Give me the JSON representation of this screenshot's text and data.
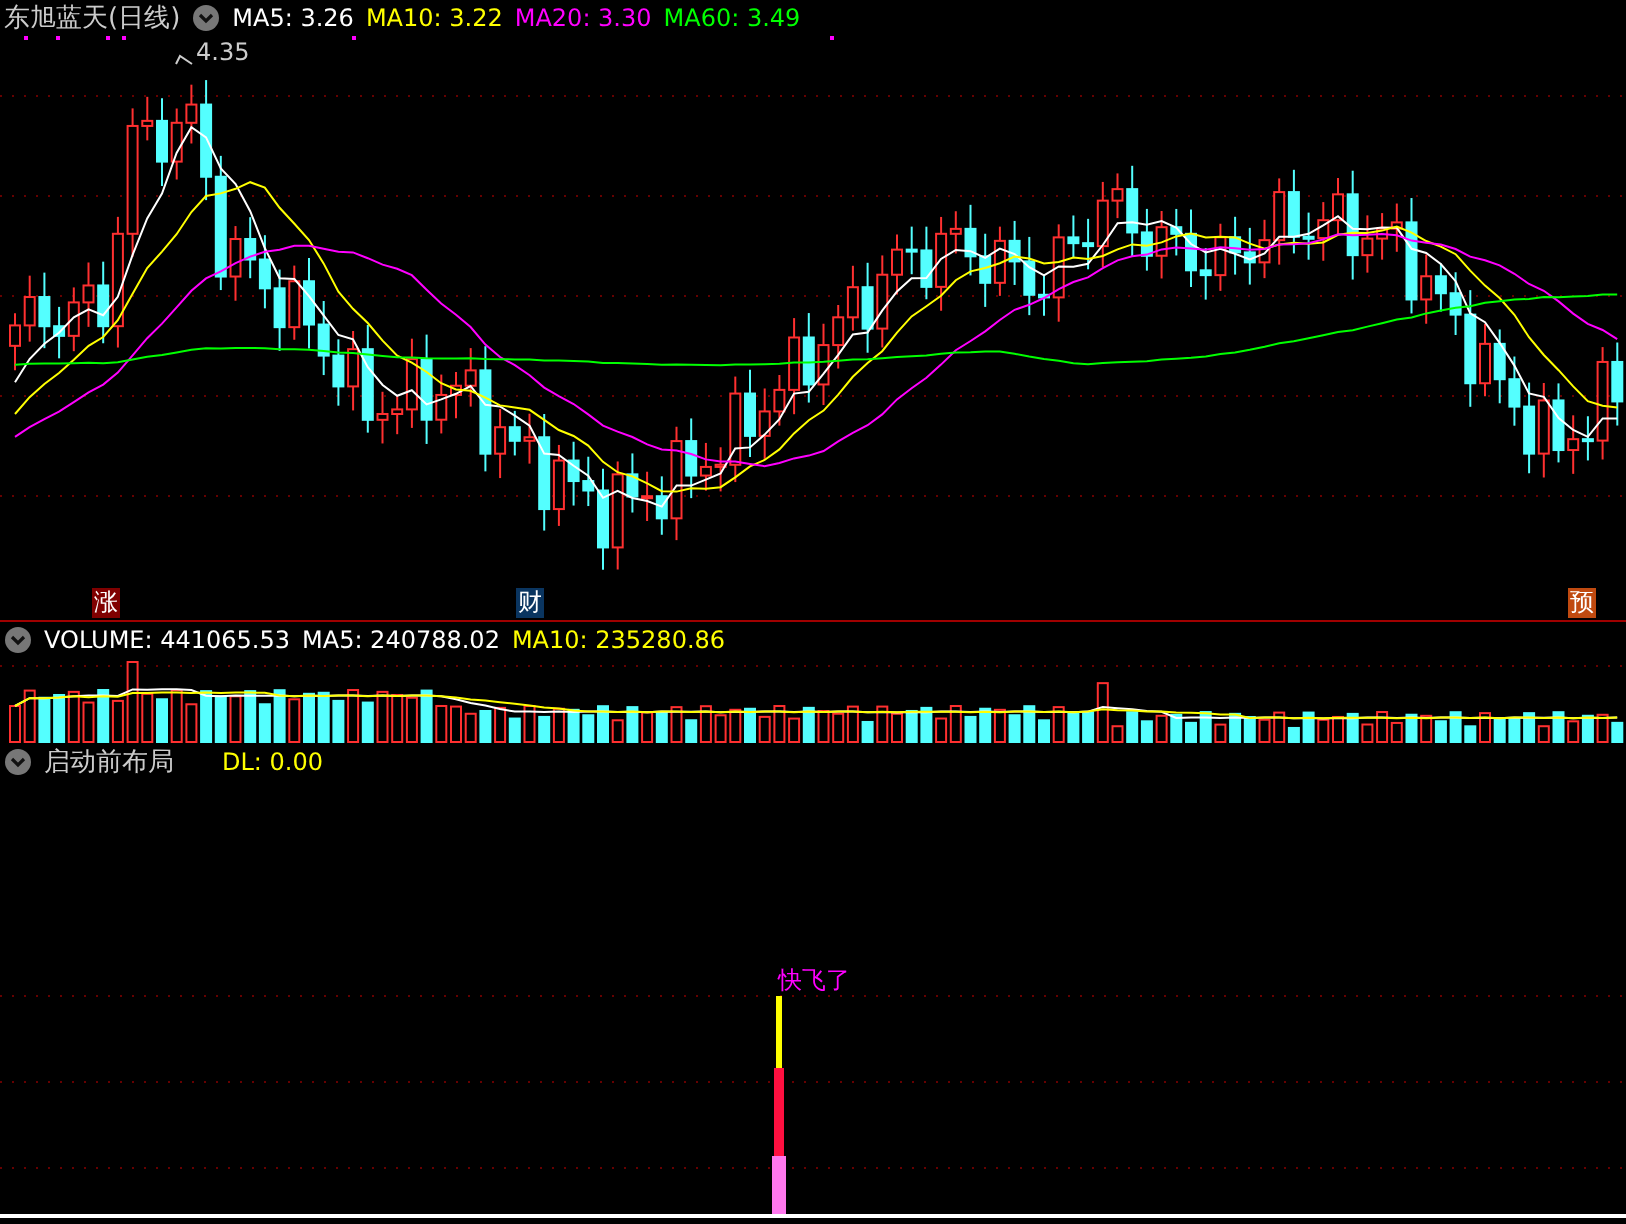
{
  "title": "东旭蓝天(日线)",
  "main_indicators": [
    {
      "label": "MA5: 3.26",
      "color": "#ffffff"
    },
    {
      "label": "MA10: 3.22",
      "color": "#ffff00"
    },
    {
      "label": "MA20: 3.30",
      "color": "#ff00ff"
    },
    {
      "label": "MA60: 3.49",
      "color": "#00ff00"
    }
  ],
  "high_label": "4.35",
  "event_marks": [
    {
      "text": "涨",
      "color": "#800000"
    },
    {
      "text": "财",
      "color": "#0a3560"
    },
    {
      "text": "预",
      "color": "#c04a10"
    }
  ],
  "volume_indicators": [
    {
      "label": "VOLUME: 441065.53",
      "color": "#ffffff"
    },
    {
      "label": "MA5: 240788.02",
      "color": "#ffffff"
    },
    {
      "label": "MA10: 235280.86",
      "color": "#ffff00"
    }
  ],
  "indicator_panel": {
    "title": "启动前布局",
    "readings": [
      {
        "label": "DL: 0.00",
        "color": "#ffff00"
      }
    ],
    "signal_label": "快飞了"
  }
}
